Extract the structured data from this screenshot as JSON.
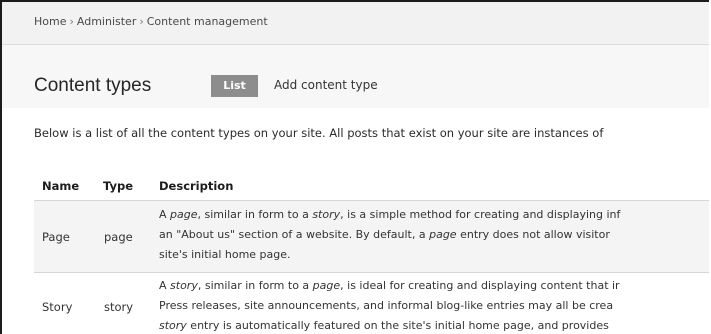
{
  "breadcrumb": {
    "items": [
      "Home",
      "Administer",
      "Content management"
    ],
    "separator": "›"
  },
  "page": {
    "title": "Content types"
  },
  "tabs": [
    {
      "label": "List",
      "active": true
    },
    {
      "label": "Add content type",
      "active": false
    }
  ],
  "intro": "Below is a list of all the content types on your site. All posts that exist on your site are instances of",
  "table": {
    "headers": [
      "Name",
      "Type",
      "Description"
    ],
    "rows": [
      {
        "name": "Page",
        "type": "page",
        "description_lines": [
          [
            "A ",
            "page",
            ", similar in form to a ",
            "story",
            ", is a simple method for creating and displaying inf"
          ],
          [
            "an \"About us\" section of a website. By default, a ",
            "page",
            " entry does not allow visitor"
          ],
          [
            "site's initial home page."
          ]
        ]
      },
      {
        "name": "Story",
        "type": "story",
        "description_lines": [
          [
            "A ",
            "story",
            ", similar in form to a ",
            "page",
            ", is ideal for creating and displaying content that ir"
          ],
          [
            "Press releases, site announcements, and informal blog-like entries may all be crea"
          ],
          [
            "",
            "story",
            " entry is automatically featured on the site's initial home page, and provides"
          ]
        ]
      }
    ]
  },
  "colors": {
    "breadcrumb_bg": "#f2f2f2",
    "title_bg": "#f7f7f7",
    "active_tab_bg": "#8d8d8d",
    "row_odd_bg": "#f4f4f4"
  }
}
